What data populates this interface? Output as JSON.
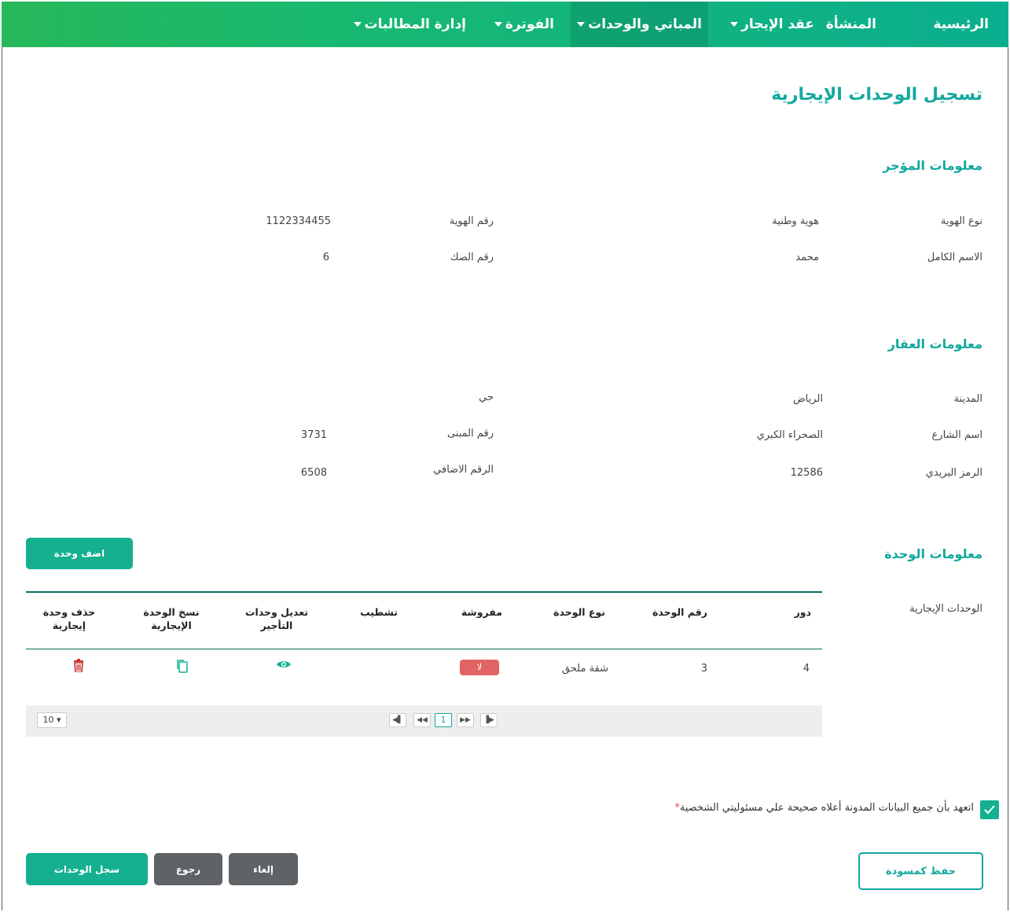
{
  "nav": {
    "home": "الرئيسية",
    "facility": "المنشأة",
    "contract": "عقد الإيجار",
    "buildings": "المباني والوحدات",
    "billing": "الفوترة",
    "claims": "إدارة المطالبات"
  },
  "page": {
    "title": "تسجيل الوحدات الإيجارية"
  },
  "lessor": {
    "section_title": "معلومات المؤجر",
    "id_type_label": "نوع الهوية",
    "id_type_value": "هوية وطنية",
    "id_number_label": "رقم الهوية",
    "id_number_value": "1122334455",
    "full_name_label": "الاسم الكامل",
    "full_name_value": "محمد",
    "deed_label": "رقم الصك",
    "deed_value": "6"
  },
  "property": {
    "section_title": "معلومات العقار",
    "city_label": "المدينة",
    "city_value": "الرياض",
    "district_label": "حي",
    "street_label": "اسم الشارع",
    "street_value": "الصحراء الكبري",
    "building_label": "رقم المبنى",
    "building_value": "3731",
    "postal_label": "الرمز البريدي",
    "postal_value": "12586",
    "additional_label": "الرقم الاضافي",
    "additional_value": "6508"
  },
  "unit": {
    "section_title": "معلومات الوحدة",
    "add_button": "اضف وحدة",
    "units_label": "الوحدات الإيجارية",
    "columns": {
      "floor": "دور",
      "unit_number": "رقم الوحدة",
      "unit_type": "نوع الوحدة",
      "furnished": "مفروشة",
      "finishing": "تشطيب",
      "edit_line1": "تعديل وحدات",
      "edit_line2": "التأجير",
      "copy_line1": "نسخ الوحدة",
      "copy_line2": "الإيجارية",
      "delete_line1": "حذف وحدة",
      "delete_line2": "إيجارية"
    },
    "rows": [
      {
        "floor": "4",
        "unit_number": "3",
        "unit_type": "شقة ملحق",
        "furnished": "لا",
        "finishing": ""
      }
    ],
    "pager": {
      "current_page": "1",
      "page_size": "10"
    }
  },
  "pledge": {
    "text": "اتعهد بأن جميع البيانات المدونة أعلاه صحيحة علي مسئوليتي الشخصية",
    "required_mark": "*"
  },
  "actions": {
    "save_draft": "حفظ كمسودة",
    "cancel": "إلغاء",
    "back": "رجوع",
    "register": "سجل الوحدات"
  },
  "colors": {
    "accent": "#13a89e",
    "nav_start": "#0aae8e",
    "nav_end": "#27b85a",
    "danger": "#e06464",
    "gray_button": "#5f6266"
  }
}
